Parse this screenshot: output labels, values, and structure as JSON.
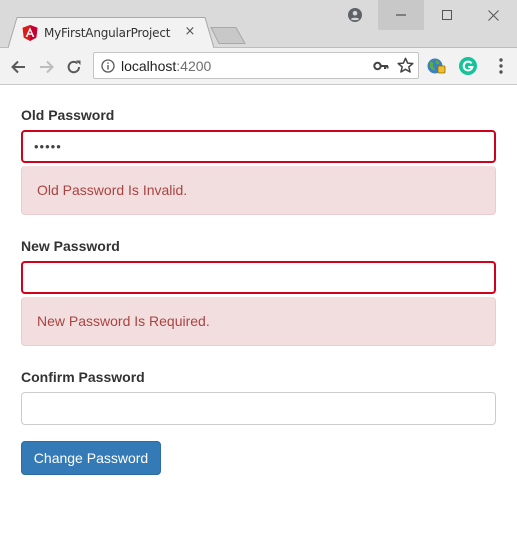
{
  "browser": {
    "tab_title": "MyFirstAngularProject",
    "tab_close": "×",
    "url_host": "localhost",
    "url_port": ":4200"
  },
  "form": {
    "old_password": {
      "label": "Old Password",
      "value": "•••••",
      "error": "Old Password Is Invalid."
    },
    "new_password": {
      "label": "New Password",
      "value": "",
      "error": "New Password Is Required."
    },
    "confirm_password": {
      "label": "Confirm Password",
      "value": ""
    },
    "submit_label": "Change Password"
  },
  "colors": {
    "error_border": "#d0021b",
    "alert_bg": "#f2dede",
    "alert_text": "#a94442",
    "primary_button": "#337ab7",
    "angular_red": "#dd1b16"
  },
  "icons": {
    "tab_favicon": "angular-logo-icon",
    "profile": "account-circle-icon",
    "minimize": "minimize-icon",
    "maximize": "maximize-icon",
    "close": "close-icon",
    "back": "back-arrow-icon",
    "forward": "forward-arrow-icon",
    "reload": "reload-icon",
    "site_info": "info-icon",
    "password_key": "key-icon",
    "bookmark": "star-icon",
    "extension_1": "globe-extension-icon",
    "extension_2": "grammarly-icon",
    "menu": "kebab-menu-icon"
  }
}
